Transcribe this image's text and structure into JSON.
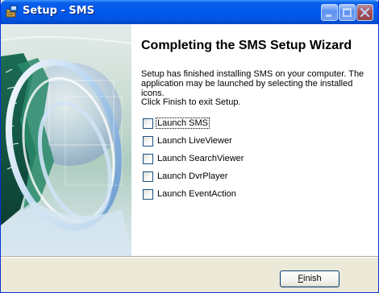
{
  "window": {
    "title": "Setup - SMS"
  },
  "icons": {
    "app": "setup-package-icon",
    "minimize": "minimize-icon",
    "maximize": "maximize-icon",
    "close": "close-icon"
  },
  "main": {
    "heading": "Completing the SMS Setup Wizard",
    "paragraph1": "Setup has finished installing SMS on your computer. The application may be launched by selecting the installed icons.",
    "paragraph2": "Click Finish to exit Setup.",
    "options": [
      {
        "label": "Launch SMS",
        "checked": false
      },
      {
        "label": "Launch LiveViewer",
        "checked": false
      },
      {
        "label": "Launch SearchViewer",
        "checked": false
      },
      {
        "label": "Launch DvrPlayer",
        "checked": false
      },
      {
        "label": "Launch EventAction",
        "checked": false
      }
    ]
  },
  "footer": {
    "finish_accel": "F",
    "finish_rest": "inish"
  },
  "colors": {
    "titlebar": "#0058ee",
    "dialog_bg": "#ece9d8",
    "content_bg": "#ffffff",
    "close_button": "#e04b22"
  }
}
